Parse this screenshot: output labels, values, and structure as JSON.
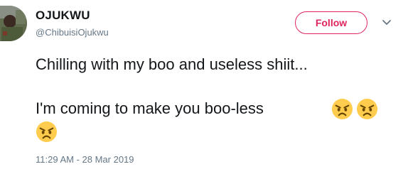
{
  "author": {
    "display_name": "OJUKWU",
    "handle": "@ChibuisiOjukwu",
    "avatar_icon": "profile-photo"
  },
  "actions": {
    "follow_label": "Follow",
    "menu_icon": "chevron-down-icon"
  },
  "tweet": {
    "line_1": "Chilling with my boo and useless shiit...",
    "line_2": "I'm coming to make you boo-less",
    "emojis": [
      "angry-face-icon",
      "angry-face-icon",
      "angry-face-icon"
    ]
  },
  "meta": {
    "timestamp": "11:29 AM - 28 Mar 2019"
  },
  "colors": {
    "follow_accent": "#e0245e",
    "secondary_text": "#657786",
    "primary_text": "#14171a"
  }
}
